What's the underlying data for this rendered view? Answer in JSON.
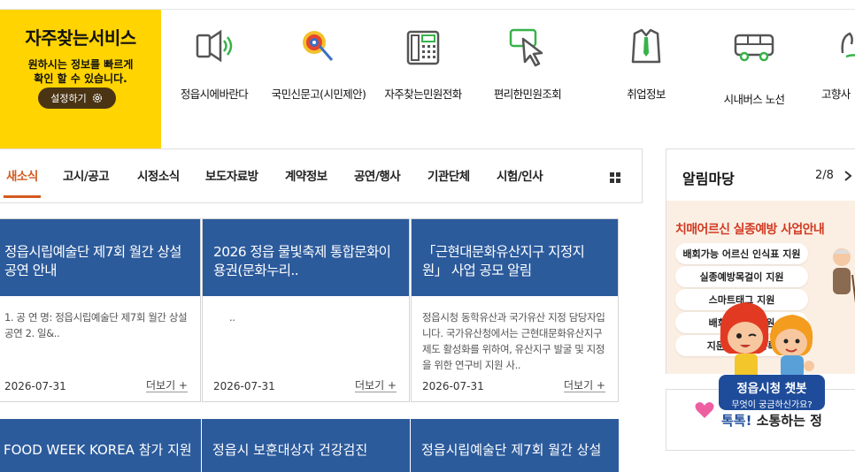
{
  "favorite": {
    "title": "자주찾는서비스",
    "desc_line1": "원하시는 정보를 빠르게",
    "desc_line2": "확인 할 수 있습니다.",
    "settings_label": "설정하기"
  },
  "services": [
    {
      "label": "정읍시에바란다",
      "icon": "speaker-icon"
    },
    {
      "label": "국민신문고(시민제안)",
      "icon": "petition-icon"
    },
    {
      "label": "자주찾는민원전화",
      "icon": "phone-icon"
    },
    {
      "label": "편리한민원조회",
      "icon": "cursor-icon"
    },
    {
      "label": "취업정보",
      "icon": "shirt-tie-icon"
    },
    {
      "label": "시내버스 노선",
      "icon": "bus-icon"
    },
    {
      "label": "고향사",
      "icon": "hand-icon"
    }
  ],
  "news": {
    "tabs": [
      "새소식",
      "고시/공고",
      "시정소식",
      "보도자료방",
      "계약정보",
      "공연/행사",
      "기관단체",
      "시험/인사"
    ],
    "active_tab": "새소식",
    "cards": [
      {
        "title": "정읍시립예술단 제7회 월간 상설공연 안내",
        "desc": "1. 공 연 명: 정읍시립예술단 제7회 월간 상설공연 2. 일&..",
        "date": "2026-07-31",
        "more": "더보기 +"
      },
      {
        "title": "2026 정읍 물빛축제 통합문화이용권(문화누리..",
        "desc": "..",
        "date": "2026-07-31",
        "more": "더보기 +"
      },
      {
        "title": "「근현대문화유산지구 지정지원」 사업 공모 알림",
        "desc": "정읍시청 동학유산과 국가유산 지정 담당자입니다. 국가유산청에서는 근현대문화유산지구 제도 활성화를 위하여, 유산지구 발굴 및 지정을 위한 연구비 지원 사..",
        "date": "2026-07-31",
        "more": "더보기 +"
      }
    ],
    "next_cards": [
      {
        "title": "FOOD WEEK KOREA 참가 지원"
      },
      {
        "title": "정읍시 보훈대상자 건강검진"
      },
      {
        "title": "정읍시립예술단 제7회 월간 상설"
      }
    ]
  },
  "notice": {
    "title": "알림마당",
    "page": "2/8",
    "banner": {
      "title": "치매어르신 실종예방 사업안내",
      "items": [
        "배회가능 어르신 인식표 지원",
        "실종예방목걸이 지원",
        "스마트태그 지원",
        "배회감지기 지원",
        "지문 등 사전등록"
      ]
    }
  },
  "chatbot": {
    "name": "정읍시청 챗봇",
    "subtitle": "무엇이 궁금하신가요?"
  },
  "talk_banner": {
    "prefix": "톡톡!",
    "text": "소통하는 정"
  },
  "colors": {
    "brand_yellow": "#ffd400",
    "card_blue": "#2c5b9c",
    "accent_orange": "#d3591e"
  }
}
